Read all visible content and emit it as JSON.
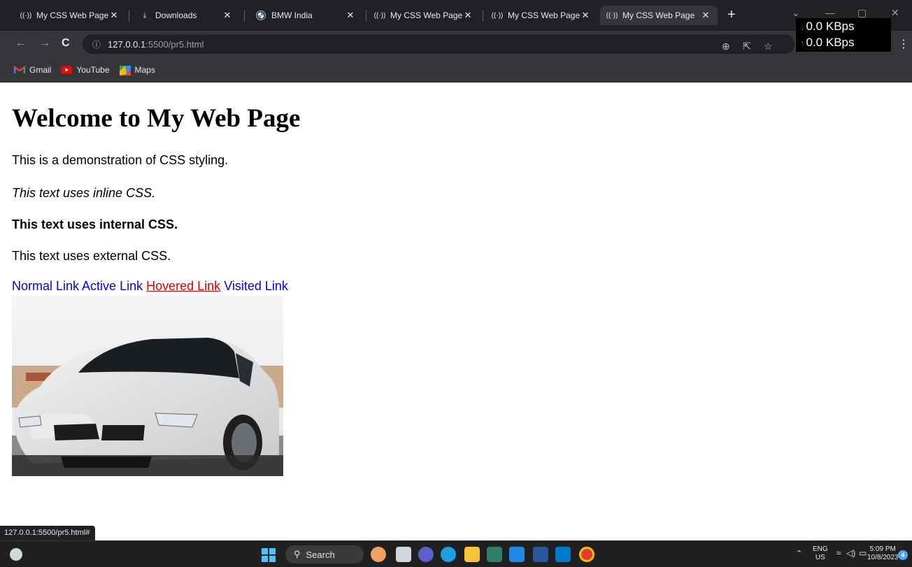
{
  "browser": {
    "tabs": [
      {
        "label": "My CSS Web Page",
        "icon": "radio-wave-icon"
      },
      {
        "label": "Downloads",
        "icon": "download-icon"
      },
      {
        "label": "BMW India",
        "icon": "bmw-logo-icon"
      },
      {
        "label": "My CSS Web Page",
        "icon": "radio-wave-icon"
      },
      {
        "label": "My CSS Web Page",
        "icon": "radio-wave-icon"
      },
      {
        "label": "My CSS Web Page",
        "icon": "radio-wave-icon"
      }
    ],
    "active_tab": 5,
    "url_host": "127.0.0.1",
    "url_path": ":5500/pr5.html",
    "bookmarks": [
      {
        "label": "Gmail",
        "icon": "gmail-icon"
      },
      {
        "label": "YouTube",
        "icon": "youtube-icon"
      },
      {
        "label": "Maps",
        "icon": "maps-icon"
      }
    ],
    "status_url": "127.0.0.1:5500/pr5.html#"
  },
  "net_meter": {
    "down": "0.0 KBps",
    "up": "0.0 KBps"
  },
  "page": {
    "heading": "Welcome to My Web Page",
    "intro": "This is a demonstration of CSS styling.",
    "inline_text": "This text uses inline CSS.",
    "internal_text": "This text uses internal CSS.",
    "external_text": "This text uses external CSS.",
    "links": {
      "normal": "Normal Link",
      "active": "Active Link",
      "hovered": "Hovered Link",
      "visited": "Visited Link"
    },
    "image_subject": "white BMW car"
  },
  "taskbar": {
    "search_label": "Search",
    "lang_top": "ENG",
    "lang_bottom": "US",
    "time": "5:09 PM",
    "date": "10/8/2023",
    "notification_count": "4"
  },
  "colors": {
    "link": "#0000ee",
    "hovered_link": "#e00000",
    "chrome_dark": "#202124",
    "chrome_toolbar": "#35363a"
  }
}
